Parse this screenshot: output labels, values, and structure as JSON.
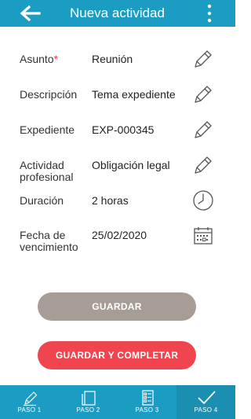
{
  "header": {
    "title": "Nueva actividad",
    "back_icon": "arrow-left-icon",
    "menu_icon": "more-vertical-icon",
    "background": "#1b9cc2"
  },
  "form": {
    "asunto": {
      "label": "Asunto",
      "required_mark": "*",
      "value": "Reunión",
      "icon": "pencil-icon"
    },
    "descripcion": {
      "label": "Descripción",
      "value": "Tema expediente",
      "icon": "pencil-icon"
    },
    "expediente": {
      "label": "Expediente",
      "value": "EXP-000345",
      "icon": "pencil-icon"
    },
    "actividad": {
      "label_line1": "Actividad",
      "label_line2": "profesional",
      "value": "Obligación legal",
      "icon": "pencil-icon"
    },
    "duracion": {
      "label": "Duración",
      "value": "2 horas",
      "icon": "clock-icon"
    },
    "fecha": {
      "label_line1": "Fecha de",
      "label_line2": "vencimiento",
      "value": "25/02/2020",
      "icon": "calendar-icon"
    }
  },
  "buttons": {
    "save": "GUARDAR",
    "save_complete": "GUARDAR Y COMPLETAR",
    "save_color": "#a89c96",
    "complete_color": "#f0454f"
  },
  "steps": [
    {
      "label": "PASO 1",
      "icon": "pencil-icon"
    },
    {
      "label": "PASO 2",
      "icon": "document-icon"
    },
    {
      "label": "PASO 3",
      "icon": "list-document-icon"
    },
    {
      "label": "PASO 4",
      "icon": "check-icon",
      "active": true
    }
  ]
}
